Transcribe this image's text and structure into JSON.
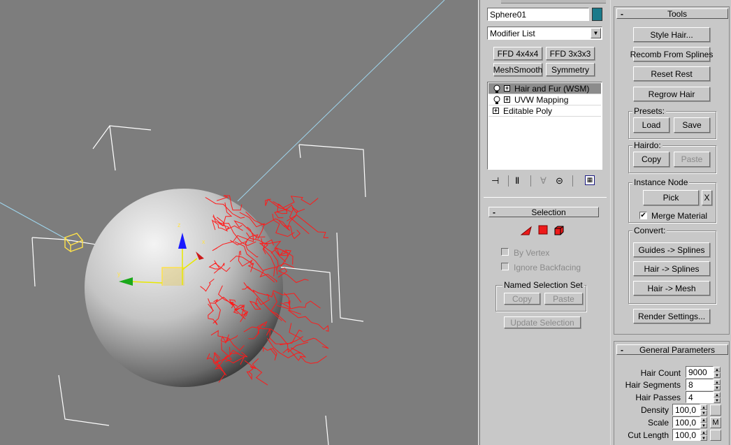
{
  "object": {
    "name": "Sphere01",
    "color": "#1a7a8a"
  },
  "modifier_list": {
    "value": "Modifier List"
  },
  "modifier_buttons": [
    "FFD 4x4x4",
    "FFD 3x3x3",
    "MeshSmooth",
    "Symmetry"
  ],
  "stack": [
    {
      "label": "Hair and Fur (WSM)",
      "selected": true,
      "bulb": true
    },
    {
      "label": "UVW Mapping",
      "selected": false,
      "bulb": true
    },
    {
      "label": "Editable Poly",
      "selected": false,
      "bulb": false
    }
  ],
  "selection": {
    "title": "Selection",
    "by_vertex": "By Vertex",
    "ignore_backfacing": "Ignore Backfacing",
    "named_selection_set": "Named Selection Set",
    "copy": "Copy",
    "paste": "Paste",
    "update_selection": "Update Selection"
  },
  "tools": {
    "title": "Tools",
    "style_hair": "Style Hair...",
    "recomb": "Recomb From Splines",
    "reset_rest": "Reset Rest",
    "regrow_hair": "Regrow Hair",
    "presets_label": "Presets:",
    "load": "Load",
    "save": "Save",
    "hairdo_label": "Hairdo:",
    "copy": "Copy",
    "paste": "Paste",
    "instance_node_label": "Instance Node",
    "pick": "Pick",
    "clear": "X",
    "merge_material": "Merge Material",
    "merge_material_checked": true,
    "convert_label": "Convert:",
    "guides_splines": "Guides -> Splines",
    "hair_splines": "Hair -> Splines",
    "hair_mesh": "Hair -> Mesh",
    "render_settings": "Render Settings..."
  },
  "general": {
    "title": "General Parameters",
    "params": [
      {
        "label": "Hair Count",
        "value": "9000"
      },
      {
        "label": "Hair Segments",
        "value": "8"
      },
      {
        "label": "Hair Passes",
        "value": "4"
      },
      {
        "label": "Density",
        "value": "100,0"
      },
      {
        "label": "Scale",
        "value": "100,0"
      },
      {
        "label": "Cut Length",
        "value": "100,0"
      }
    ],
    "map_button": "M"
  },
  "colors": {
    "accent": "#1a7a8a",
    "hair": "#ff1a1a",
    "gizmo": "#ffe24a",
    "viewport_bg": "#7d7d7d"
  }
}
